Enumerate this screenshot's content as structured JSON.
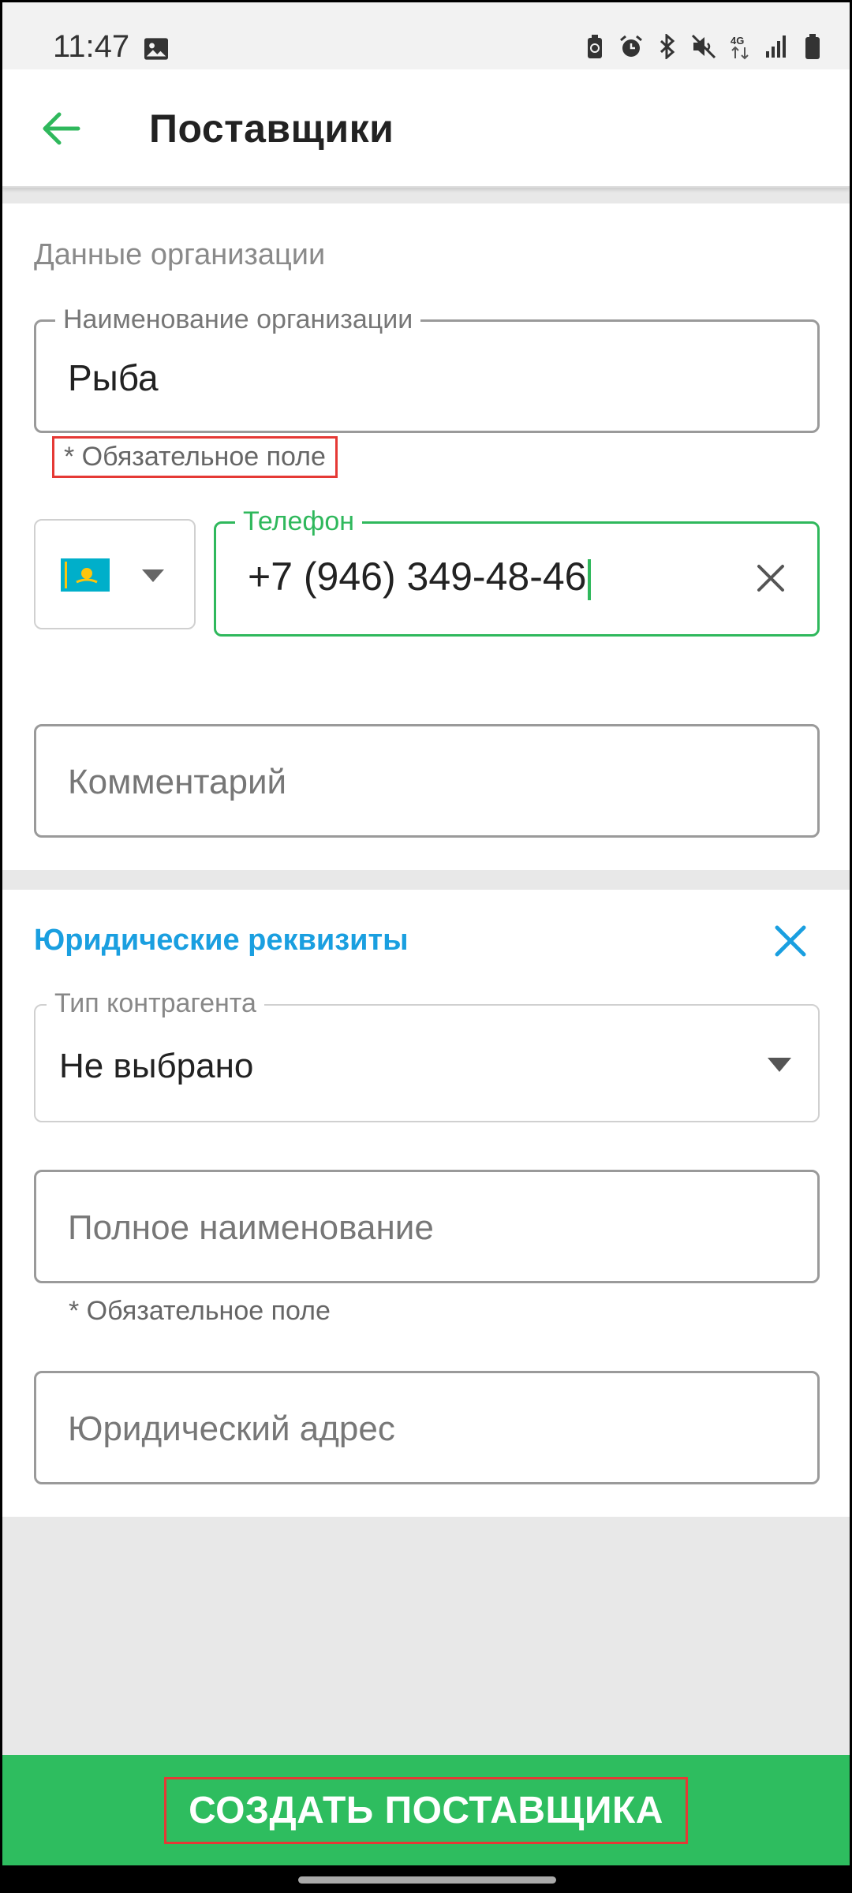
{
  "status_bar": {
    "time": "11:47",
    "icons": [
      "image-icon",
      "battery-saver-icon",
      "alarm-icon",
      "bluetooth-icon",
      "mute-icon",
      "network-4g-icon",
      "signal-icon",
      "battery-icon"
    ]
  },
  "app_bar": {
    "title": "Поставщики",
    "back_icon": "arrow-left-icon",
    "accent_color": "#2fb85c"
  },
  "org_section": {
    "title": "Данные организации",
    "name_field": {
      "label": "Наименование организации",
      "value": "Рыба",
      "helper": "* Обязательное поле"
    },
    "phone": {
      "country_flag": "kazakhstan-flag",
      "label": "Телефон",
      "value": "+7 (946) 349-48-46"
    },
    "comment_field": {
      "placeholder": "Комментарий"
    }
  },
  "legal_section": {
    "title": "Юридические реквизиты",
    "title_color": "#1a9fe0",
    "counterparty_type": {
      "label": "Тип контрагента",
      "value": "Не выбрано"
    },
    "full_name": {
      "placeholder": "Полное наименование",
      "helper": "* Обязательное поле"
    },
    "legal_address": {
      "placeholder": "Юридический адрес"
    }
  },
  "bottom_action": {
    "label": "СОЗДАТЬ ПОСТАВЩИКА",
    "color": "#2ebd5f"
  }
}
